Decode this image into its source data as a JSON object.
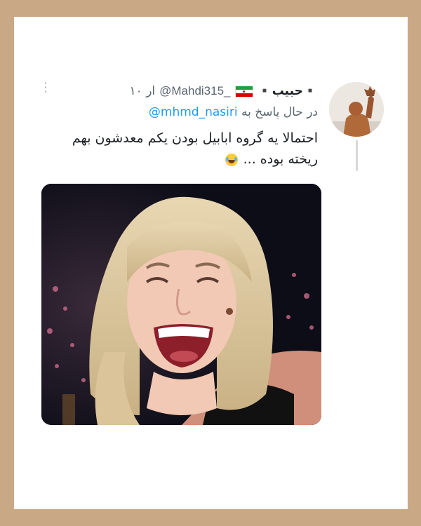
{
  "tweet": {
    "display_name": "▪️حبیب▪️",
    "handle": "@Mahdi315_",
    "time": "۱۰ ار",
    "reply_prefix": "در حال پاسخ به",
    "reply_mention": "@mhmd_nasiri",
    "text_line1": "احتمالا یه گروه ابابیل بودن یکم معدشون بهم",
    "text_line2": "ریخته بوده ..."
  },
  "icons": {
    "more": "more-vertical-icon",
    "flag": "iran-flag-icon",
    "emoji": "face-with-tears-of-joy-icon"
  },
  "colors": {
    "frame": "#c9a886",
    "card": "#ffffff",
    "mention": "#1d9bf0",
    "secondary_text": "#5b6670"
  }
}
